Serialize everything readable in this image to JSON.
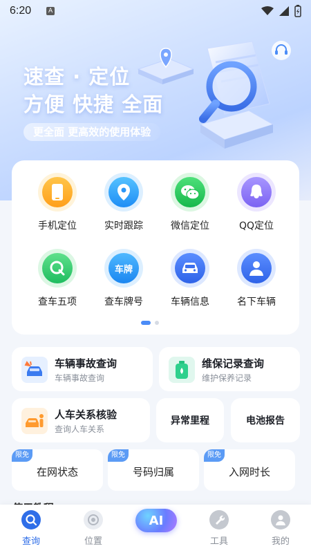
{
  "status_bar": {
    "time": "6:20",
    "notification_badge": "A"
  },
  "hero": {
    "line1": "速查 · 定位",
    "line2": "方便 快捷 全面",
    "subtitle": "更全面 更高效的使用体验"
  },
  "grid": [
    {
      "label": "手机定位",
      "icon": "phone-icon"
    },
    {
      "label": "实时跟踪",
      "icon": "location-pin-icon"
    },
    {
      "label": "微信定位",
      "icon": "wechat-icon"
    },
    {
      "label": "QQ定位",
      "icon": "qq-icon"
    },
    {
      "label": "查车五项",
      "icon": "q-search-icon"
    },
    {
      "label": "查车牌号",
      "icon": "license-plate-icon",
      "icon_text": "车牌"
    },
    {
      "label": "车辆信息",
      "icon": "car-icon"
    },
    {
      "label": "名下车辆",
      "icon": "person-icon"
    }
  ],
  "pager": {
    "total": 2,
    "active": 1
  },
  "features": {
    "accident": {
      "title": "车辆事故查询",
      "subtitle": "车辆事故查询"
    },
    "maintenance": {
      "title": "维保记录查询",
      "subtitle": "维护保养记录"
    },
    "relation": {
      "title": "人车关系核验",
      "subtitle": "查询人车关系"
    },
    "mileage": {
      "title": "异常里程"
    },
    "battery": {
      "title": "电池报告"
    }
  },
  "free_items": [
    {
      "tag": "限免",
      "label": "在网状态"
    },
    {
      "tag": "限免",
      "label": "号码归属"
    },
    {
      "tag": "限免",
      "label": "入网时长"
    }
  ],
  "section_peek": "使用教程",
  "tabbar": {
    "items": [
      {
        "label": "查询",
        "icon": "search-icon",
        "active": true
      },
      {
        "label": "位置",
        "icon": "target-icon",
        "active": false
      },
      {
        "label": "AI",
        "icon": "ai-icon",
        "active": false
      },
      {
        "label": "工具",
        "icon": "wrench-icon",
        "active": false
      },
      {
        "label": "我的",
        "icon": "user-icon",
        "active": false
      }
    ]
  },
  "colors": {
    "accent": "#2f6ee8",
    "tag_blue": "#5b9bf5"
  }
}
